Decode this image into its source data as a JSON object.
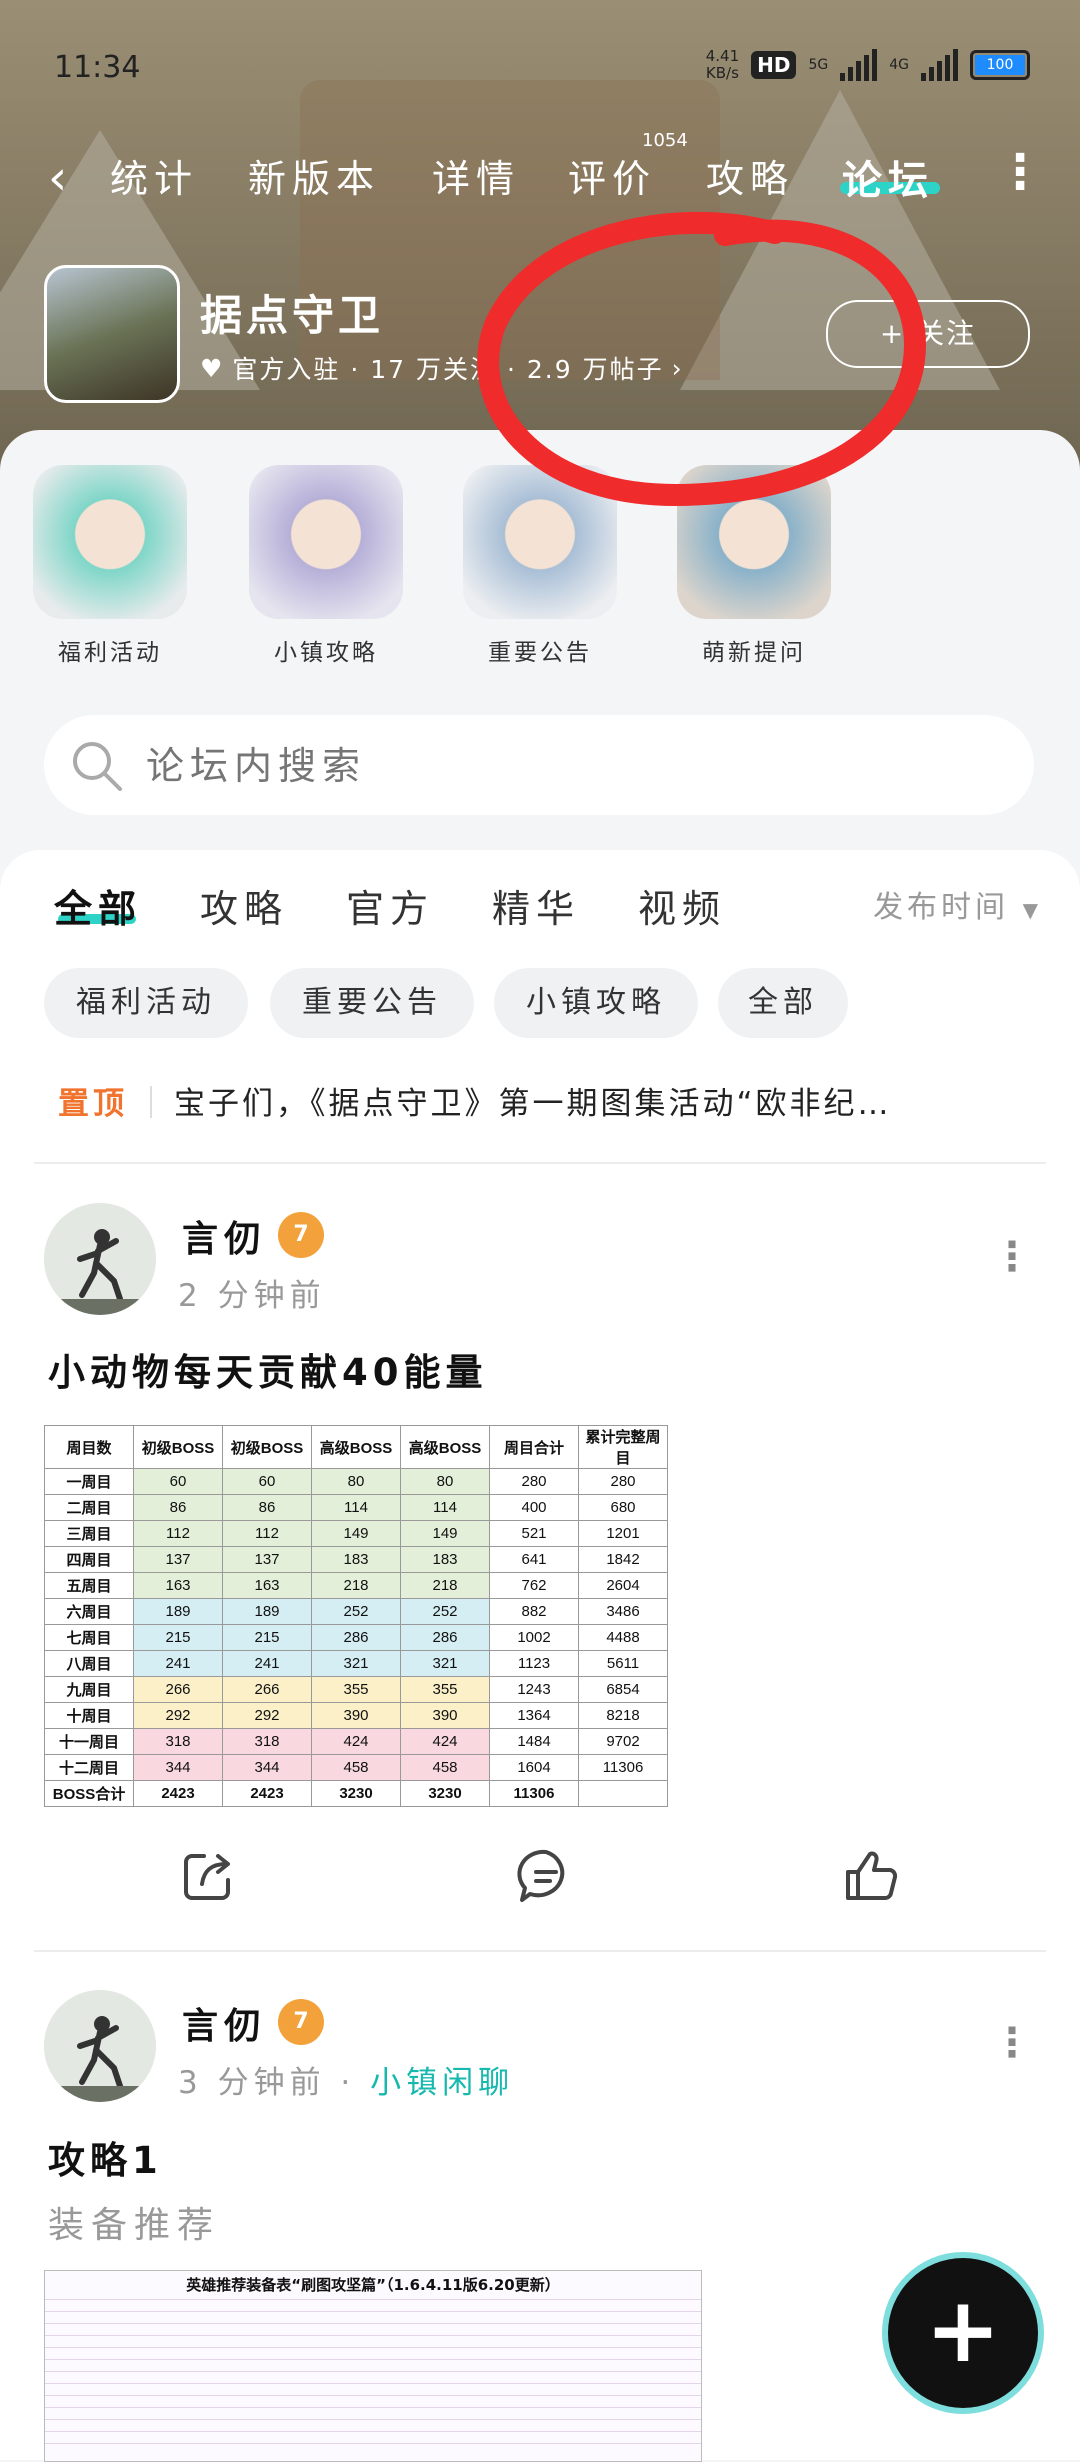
{
  "status_bar": {
    "time": "11:34",
    "net_speed": "4.41",
    "net_unit": "KB/s",
    "hd_label": "HD",
    "net_5g": "5G",
    "net_4g": "4G",
    "battery": "100"
  },
  "nav": {
    "back_icon": "chevron-left-icon",
    "items": [
      "统计",
      "新版本",
      "详情",
      "评价",
      "攻略",
      "论坛"
    ],
    "review_count": "1054",
    "active": "论坛",
    "more_icon": "more-vertical-icon"
  },
  "game": {
    "title": "据点守卫",
    "meta": "官方入驻 · 17 万关注 · 2.9 万帖子",
    "follow_label": "+ 关注"
  },
  "shortcuts": [
    {
      "label": "福利活动",
      "color": "#7fd6c8"
    },
    {
      "label": "小镇攻略",
      "color": "#b6b0d8"
    },
    {
      "label": "重要公告",
      "color": "#a9bfd6"
    },
    {
      "label": "萌新提问",
      "color": "#c9c0b4"
    }
  ],
  "search": {
    "placeholder": "论坛内搜索"
  },
  "tabs": [
    "全部",
    "攻略",
    "官方",
    "精华",
    "视频"
  ],
  "sort_label": "发布时间",
  "chips": [
    "福利活动",
    "重要公告",
    "小镇攻略",
    "全部"
  ],
  "pinned": {
    "tag": "置顶",
    "text": "宝子们，《据点守卫》第一期图集活动“欧非纪…"
  },
  "posts": [
    {
      "author": "言仞",
      "level": "7",
      "time": "2 分钟前",
      "title": "小动物每天贡献40能量",
      "table": {
        "headers": [
          "周目数",
          "初级BOSS",
          "初级BOSS",
          "高级BOSS",
          "高级BOSS",
          "周目合计",
          "累计完整周目"
        ],
        "rows": [
          [
            "一周目",
            "60",
            "60",
            "80",
            "80",
            "280",
            "280"
          ],
          [
            "二周目",
            "86",
            "86",
            "114",
            "114",
            "400",
            "680"
          ],
          [
            "三周目",
            "112",
            "112",
            "149",
            "149",
            "521",
            "1201"
          ],
          [
            "四周目",
            "137",
            "137",
            "183",
            "183",
            "641",
            "1842"
          ],
          [
            "五周目",
            "163",
            "163",
            "218",
            "218",
            "762",
            "2604"
          ],
          [
            "六周目",
            "189",
            "189",
            "252",
            "252",
            "882",
            "3486"
          ],
          [
            "七周目",
            "215",
            "215",
            "286",
            "286",
            "1002",
            "4488"
          ],
          [
            "八周目",
            "241",
            "241",
            "321",
            "321",
            "1123",
            "5611"
          ],
          [
            "九周目",
            "266",
            "266",
            "355",
            "355",
            "1243",
            "6854"
          ],
          [
            "十周目",
            "292",
            "292",
            "390",
            "390",
            "1364",
            "8218"
          ],
          [
            "十一周目",
            "318",
            "318",
            "424",
            "424",
            "1484",
            "9702"
          ],
          [
            "十二周目",
            "344",
            "344",
            "458",
            "458",
            "1604",
            "11306"
          ],
          [
            "BOSS合计",
            "2423",
            "2423",
            "3230",
            "3230",
            "11306",
            ""
          ]
        ]
      }
    },
    {
      "author": "言仞",
      "level": "7",
      "time": "3 分钟前",
      "topic": "小镇闲聊",
      "title": "攻略1",
      "subtitle": "装备推荐",
      "image_title": "英雄推荐装备表“刷图攻坚篇”（1.6.4.11版6.20更新）"
    }
  ],
  "fab_icon": "plus-icon"
}
